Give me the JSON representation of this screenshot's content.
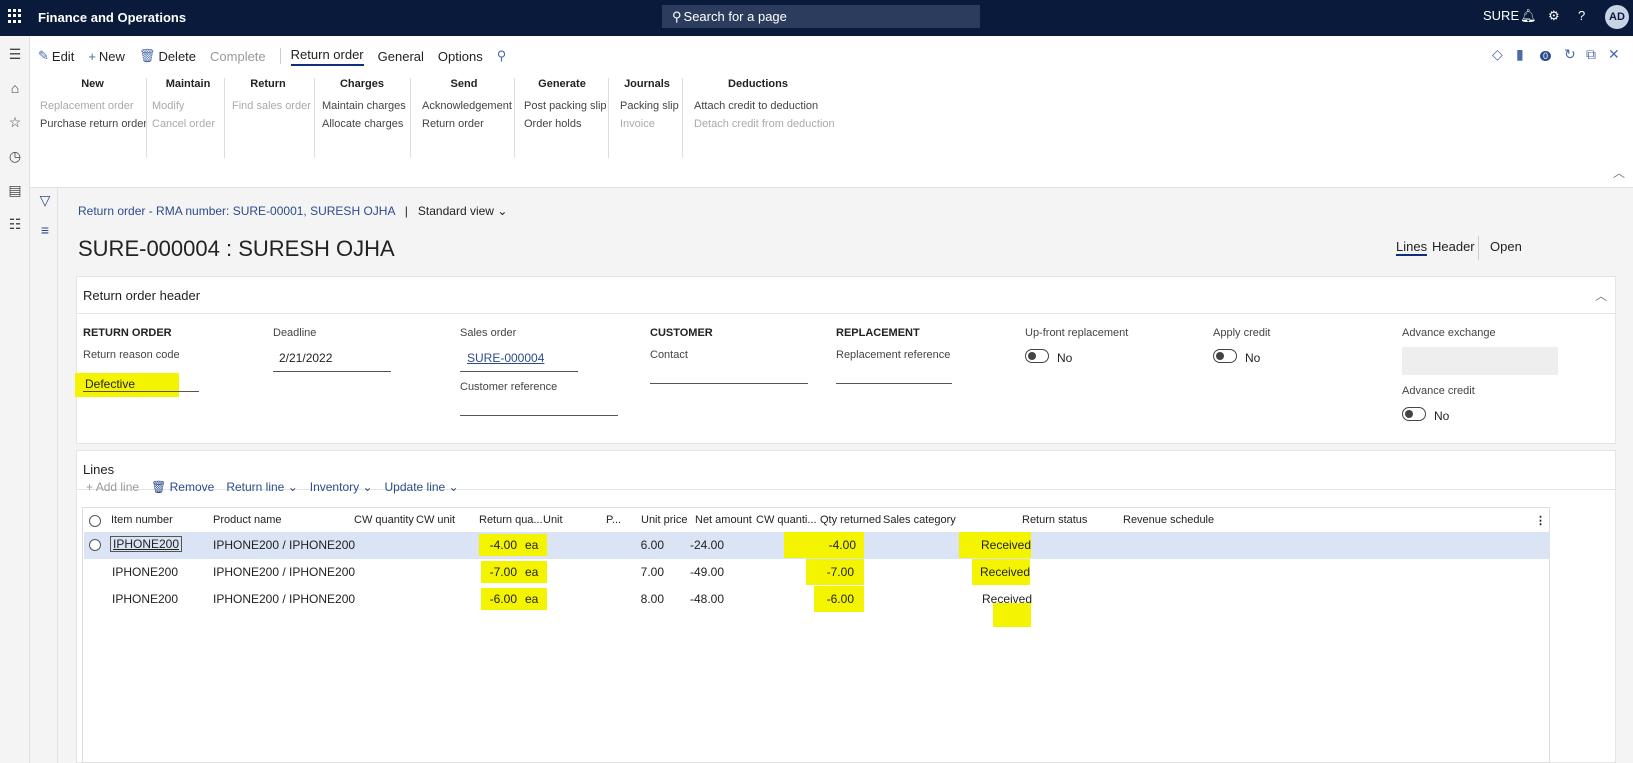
{
  "topbar": {
    "app_title": "Finance and Operations",
    "search_placeholder": "Search for a page",
    "company": "SURE",
    "avatar_initials": "AD"
  },
  "actionpane": {
    "tabs": [
      {
        "label": "Edit",
        "icon": "pencil-icon"
      },
      {
        "label": "New",
        "icon": "plus-icon"
      },
      {
        "label": "Delete",
        "icon": "trash-icon"
      },
      {
        "label": "Complete"
      },
      {
        "label": "Return order"
      },
      {
        "label": "General"
      },
      {
        "label": "Options"
      }
    ],
    "groups": [
      {
        "title": "New",
        "items": [
          {
            "label": "Replacement order",
            "disabled": true
          },
          {
            "label": "Purchase return order",
            "disabled": false
          }
        ]
      },
      {
        "title": "Maintain",
        "items": [
          {
            "label": "Modify",
            "disabled": true
          },
          {
            "label": "Cancel order",
            "disabled": true
          }
        ]
      },
      {
        "title": "Return",
        "items": [
          {
            "label": "Find sales order",
            "disabled": true
          }
        ]
      },
      {
        "title": "Charges",
        "items": [
          {
            "label": "Maintain charges",
            "disabled": false
          },
          {
            "label": "Allocate charges",
            "disabled": false
          }
        ]
      },
      {
        "title": "Send",
        "items": [
          {
            "label": "Acknowledgement",
            "disabled": false
          },
          {
            "label": "Return order",
            "disabled": false
          }
        ]
      },
      {
        "title": "Generate",
        "items": [
          {
            "label": "Post packing slip",
            "disabled": false
          },
          {
            "label": "Order holds",
            "disabled": false
          }
        ]
      },
      {
        "title": "Journals",
        "items": [
          {
            "label": "Packing slip",
            "disabled": false
          },
          {
            "label": "Invoice",
            "disabled": true
          }
        ]
      },
      {
        "title": "Deductions",
        "items": [
          {
            "label": "Attach credit to deduction",
            "disabled": false
          },
          {
            "label": "Detach credit from deduction",
            "disabled": true
          }
        ]
      }
    ],
    "badge": "0"
  },
  "page": {
    "breadcrumb": "Return order - RMA number: SURE-00001, SURESH OJHA",
    "view": "Standard view",
    "title": "SURE-000004 : SURESH OJHA",
    "viewtabs": [
      "Lines",
      "Header",
      "Open"
    ]
  },
  "header_card": {
    "title": "Return order header",
    "return_order_head": "RETURN ORDER",
    "reason_code_label": "Return reason code",
    "reason_code_value": "Defective",
    "deadline_label": "Deadline",
    "deadline_value": "2/21/2022",
    "sales_order_label": "Sales order",
    "sales_order_value": "SURE-000004",
    "customer_reference_label": "Customer reference",
    "customer_head": "CUSTOMER",
    "contact_label": "Contact",
    "replacement_head": "REPLACEMENT",
    "replacement_reference_label": "Replacement reference",
    "upfront_label": "Up-front replacement",
    "upfront_value": "No",
    "apply_credit_label": "Apply credit",
    "apply_credit_value": "No",
    "advance_exchange_label": "Advance exchange",
    "advance_credit_label": "Advance credit",
    "advance_credit_value": "No"
  },
  "lines_card": {
    "title": "Lines",
    "toolbar": [
      "Add line",
      "Remove",
      "Return line",
      "Inventory",
      "Update line"
    ],
    "columns": [
      "Item number",
      "Product name",
      "CW quantity",
      "CW unit",
      "Return qua...",
      "Unit",
      "P...",
      "Unit price",
      "Net amount",
      "CW quanti...",
      "Qty returned",
      "Sales category",
      "Return status",
      "Revenue schedule"
    ],
    "rows": [
      {
        "item": "IPHONE200",
        "product": "IPHONE200 / IPHONE200",
        "return_qty": "-4.00",
        "unit": "ea",
        "unit_price": "6.00",
        "net_amount": "-24.00",
        "qty_returned": "-4.00",
        "status": "Received"
      },
      {
        "item": "IPHONE200",
        "product": "IPHONE200 / IPHONE200",
        "return_qty": "-7.00",
        "unit": "ea",
        "unit_price": "7.00",
        "net_amount": "-49.00",
        "qty_returned": "-7.00",
        "status": "Received"
      },
      {
        "item": "IPHONE200",
        "product": "IPHONE200 / IPHONE200",
        "return_qty": "-6.00",
        "unit": "ea",
        "unit_price": "8.00",
        "net_amount": "-48.00",
        "qty_returned": "-6.00",
        "status": "Received"
      }
    ]
  },
  "colors": {
    "nav": "#0a1a3a",
    "accent": "#2b4c8c",
    "highlight": "#f4f400",
    "selected_row": "#dbe4f4"
  }
}
